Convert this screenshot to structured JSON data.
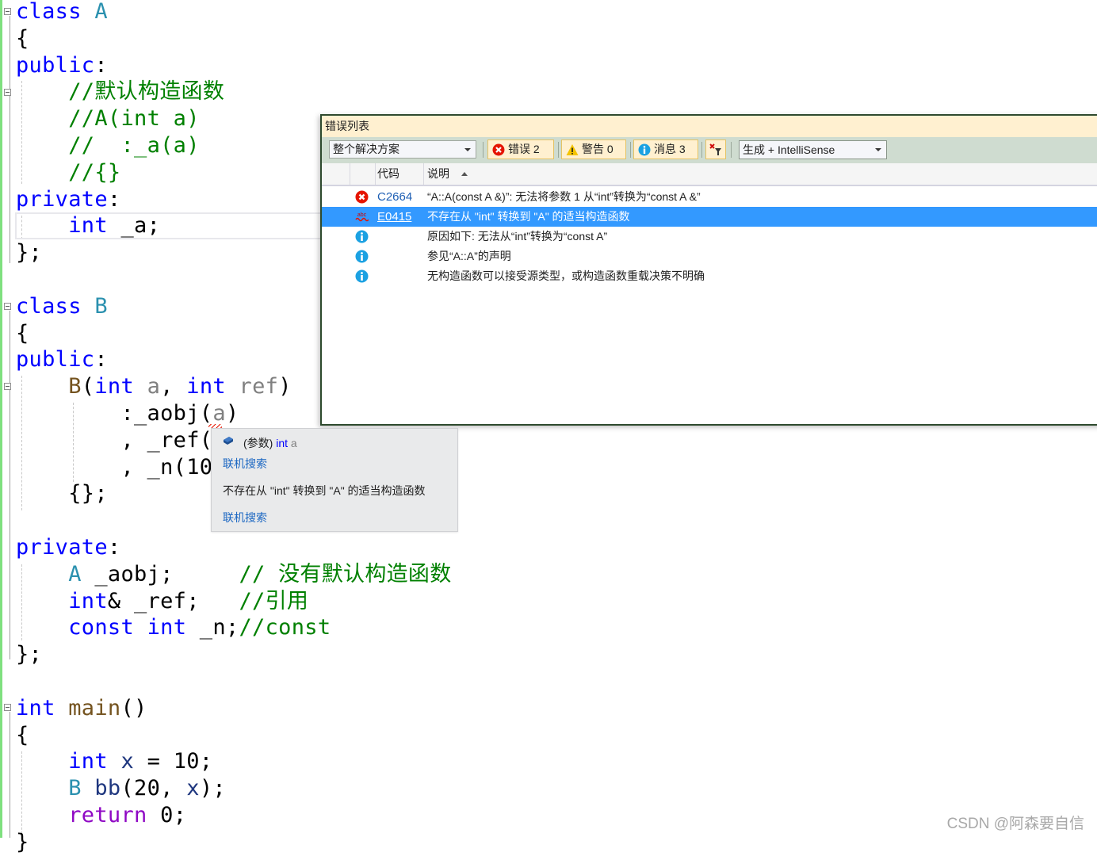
{
  "editor": {
    "lines": [
      {
        "tokens": [
          {
            "t": "class",
            "c": "kw"
          },
          {
            "t": " "
          },
          {
            "t": "A",
            "c": "cls"
          }
        ]
      },
      {
        "tokens": [
          {
            "t": "{"
          }
        ]
      },
      {
        "tokens": [
          {
            "t": "public",
            "c": "kw"
          },
          {
            "t": ":"
          }
        ]
      },
      {
        "tokens": [
          {
            "t": "    "
          },
          {
            "t": "//默认构造函数",
            "c": "cm"
          }
        ]
      },
      {
        "tokens": [
          {
            "t": "    "
          },
          {
            "t": "//A(int a)",
            "c": "cm"
          }
        ]
      },
      {
        "tokens": [
          {
            "t": "    "
          },
          {
            "t": "//  :_a(a)",
            "c": "cm"
          }
        ]
      },
      {
        "tokens": [
          {
            "t": "    "
          },
          {
            "t": "//{}",
            "c": "cm"
          }
        ]
      },
      {
        "tokens": [
          {
            "t": "private",
            "c": "kw"
          },
          {
            "t": ":"
          }
        ]
      },
      {
        "tokens": [
          {
            "t": "    "
          },
          {
            "t": "int",
            "c": "kw"
          },
          {
            "t": " _a;"
          }
        ]
      },
      {
        "tokens": [
          {
            "t": "};"
          }
        ]
      },
      {
        "tokens": []
      },
      {
        "tokens": [
          {
            "t": "class",
            "c": "kw"
          },
          {
            "t": " "
          },
          {
            "t": "B",
            "c": "cls"
          }
        ]
      },
      {
        "tokens": [
          {
            "t": "{"
          }
        ]
      },
      {
        "tokens": [
          {
            "t": "public",
            "c": "kw"
          },
          {
            "t": ":"
          }
        ]
      },
      {
        "tokens": [
          {
            "t": "    "
          },
          {
            "t": "B",
            "c": "fn"
          },
          {
            "t": "("
          },
          {
            "t": "int",
            "c": "kw"
          },
          {
            "t": " "
          },
          {
            "t": "a",
            "c": "param"
          },
          {
            "t": ", "
          },
          {
            "t": "int",
            "c": "kw"
          },
          {
            "t": " "
          },
          {
            "t": "ref",
            "c": "param"
          },
          {
            "t": ")"
          }
        ]
      },
      {
        "tokens": [
          {
            "t": "        :_aobj("
          },
          {
            "t": "a",
            "c": "param"
          },
          {
            "t": ")"
          }
        ]
      },
      {
        "tokens": [
          {
            "t": "        , _ref("
          }
        ]
      },
      {
        "tokens": [
          {
            "t": "        , _n(10"
          }
        ]
      },
      {
        "tokens": [
          {
            "t": "    {};"
          }
        ]
      },
      {
        "tokens": []
      },
      {
        "tokens": [
          {
            "t": "private",
            "c": "kw"
          },
          {
            "t": ":"
          }
        ]
      },
      {
        "tokens": [
          {
            "t": "    "
          },
          {
            "t": "A",
            "c": "cls"
          },
          {
            "t": " _aobj;     "
          },
          {
            "t": "// 没有默认构造函数",
            "c": "cm"
          }
        ]
      },
      {
        "tokens": [
          {
            "t": "    "
          },
          {
            "t": "int",
            "c": "kw"
          },
          {
            "t": "& _ref;   "
          },
          {
            "t": "//引用",
            "c": "cm"
          }
        ]
      },
      {
        "tokens": [
          {
            "t": "    "
          },
          {
            "t": "const",
            "c": "kw"
          },
          {
            "t": " "
          },
          {
            "t": "int",
            "c": "kw"
          },
          {
            "t": " _n;"
          },
          {
            "t": "//const",
            "c": "cm"
          }
        ]
      },
      {
        "tokens": [
          {
            "t": "};"
          }
        ]
      },
      {
        "tokens": []
      },
      {
        "tokens": [
          {
            "t": "int",
            "c": "kw"
          },
          {
            "t": " "
          },
          {
            "t": "main",
            "c": "fn"
          },
          {
            "t": "()"
          }
        ]
      },
      {
        "tokens": [
          {
            "t": "{"
          }
        ]
      },
      {
        "tokens": [
          {
            "t": "    "
          },
          {
            "t": "int",
            "c": "kw"
          },
          {
            "t": " "
          },
          {
            "t": "x",
            "c": "var"
          },
          {
            "t": " = 10;"
          }
        ]
      },
      {
        "tokens": [
          {
            "t": "    "
          },
          {
            "t": "B",
            "c": "cls"
          },
          {
            "t": " "
          },
          {
            "t": "bb",
            "c": "var"
          },
          {
            "t": "(20, "
          },
          {
            "t": "x",
            "c": "var"
          },
          {
            "t": ");"
          }
        ]
      },
      {
        "tokens": [
          {
            "t": "    "
          },
          {
            "t": "return",
            "c": "ret"
          },
          {
            "t": " 0;"
          }
        ]
      },
      {
        "tokens": [
          {
            "t": "}"
          }
        ]
      }
    ]
  },
  "error_list": {
    "title": "错误列表",
    "scope": "整个解决方案",
    "errors_btn": "错误 2",
    "warnings_btn": "警告 0",
    "messages_btn": "消息 3",
    "build_filter": "生成 + IntelliSense",
    "columns": {
      "code": "代码",
      "description": "说明"
    },
    "rows": [
      {
        "icon": "error-icon",
        "code": "C2664",
        "description": "“A::A(const A &)”: 无法将参数 1 从“int”转换为“const A &”",
        "selected": false
      },
      {
        "icon": "intellisense-error-icon",
        "code": "E0415",
        "description": "不存在从 \"int\" 转换到 \"A\" 的适当构造函数",
        "selected": true
      },
      {
        "icon": "info-icon",
        "code": "",
        "description": "原因如下: 无法从“int”转换为“const A”",
        "selected": false
      },
      {
        "icon": "info-icon",
        "code": "",
        "description": "参见“A::A”的声明",
        "selected": false
      },
      {
        "icon": "info-icon",
        "code": "",
        "description": "无构造函数可以接受源类型，或构造函数重载决策不明确",
        "selected": false
      }
    ]
  },
  "tooltip": {
    "prefix": "(参数)",
    "type": "int",
    "name": "a",
    "search_link_1": "联机搜索",
    "message": "不存在从 \"int\" 转换到 \"A\" 的适当构造函数",
    "search_link_2": "联机搜索"
  },
  "watermark": "CSDN @阿森要自信"
}
